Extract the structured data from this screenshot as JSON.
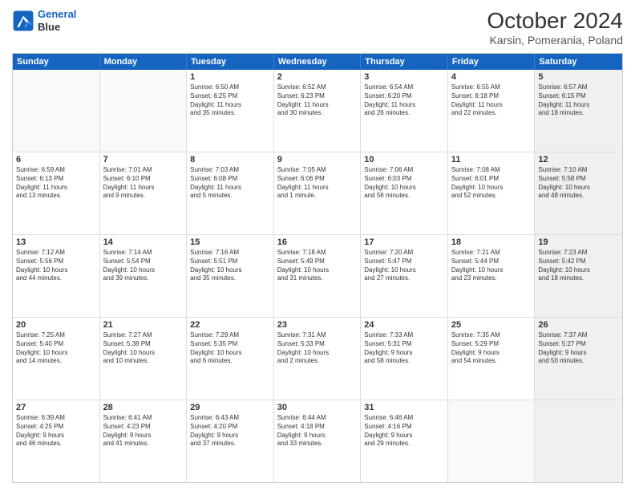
{
  "header": {
    "logo_line1": "General",
    "logo_line2": "Blue",
    "month": "October 2024",
    "location": "Karsin, Pomerania, Poland"
  },
  "weekdays": [
    "Sunday",
    "Monday",
    "Tuesday",
    "Wednesday",
    "Thursday",
    "Friday",
    "Saturday"
  ],
  "rows": [
    {
      "cells": [
        {
          "day": "",
          "info": "",
          "empty": true
        },
        {
          "day": "",
          "info": "",
          "empty": true
        },
        {
          "day": "1",
          "info": "Sunrise: 6:50 AM\nSunset: 6:25 PM\nDaylight: 11 hours\nand 35 minutes."
        },
        {
          "day": "2",
          "info": "Sunrise: 6:52 AM\nSunset: 6:23 PM\nDaylight: 11 hours\nand 30 minutes."
        },
        {
          "day": "3",
          "info": "Sunrise: 6:54 AM\nSunset: 6:20 PM\nDaylight: 11 hours\nand 26 minutes."
        },
        {
          "day": "4",
          "info": "Sunrise: 6:55 AM\nSunset: 6:18 PM\nDaylight: 11 hours\nand 22 minutes."
        },
        {
          "day": "5",
          "info": "Sunrise: 6:57 AM\nSunset: 6:15 PM\nDaylight: 11 hours\nand 18 minutes.",
          "shaded": true
        }
      ]
    },
    {
      "cells": [
        {
          "day": "6",
          "info": "Sunrise: 6:59 AM\nSunset: 6:13 PM\nDaylight: 11 hours\nand 13 minutes."
        },
        {
          "day": "7",
          "info": "Sunrise: 7:01 AM\nSunset: 6:10 PM\nDaylight: 11 hours\nand 9 minutes."
        },
        {
          "day": "8",
          "info": "Sunrise: 7:03 AM\nSunset: 6:08 PM\nDaylight: 11 hours\nand 5 minutes."
        },
        {
          "day": "9",
          "info": "Sunrise: 7:05 AM\nSunset: 6:06 PM\nDaylight: 11 hours\nand 1 minute."
        },
        {
          "day": "10",
          "info": "Sunrise: 7:06 AM\nSunset: 6:03 PM\nDaylight: 10 hours\nand 56 minutes."
        },
        {
          "day": "11",
          "info": "Sunrise: 7:08 AM\nSunset: 6:01 PM\nDaylight: 10 hours\nand 52 minutes."
        },
        {
          "day": "12",
          "info": "Sunrise: 7:10 AM\nSunset: 5:58 PM\nDaylight: 10 hours\nand 48 minutes.",
          "shaded": true
        }
      ]
    },
    {
      "cells": [
        {
          "day": "13",
          "info": "Sunrise: 7:12 AM\nSunset: 5:56 PM\nDaylight: 10 hours\nand 44 minutes."
        },
        {
          "day": "14",
          "info": "Sunrise: 7:14 AM\nSunset: 5:54 PM\nDaylight: 10 hours\nand 39 minutes."
        },
        {
          "day": "15",
          "info": "Sunrise: 7:16 AM\nSunset: 5:51 PM\nDaylight: 10 hours\nand 35 minutes."
        },
        {
          "day": "16",
          "info": "Sunrise: 7:18 AM\nSunset: 5:49 PM\nDaylight: 10 hours\nand 31 minutes."
        },
        {
          "day": "17",
          "info": "Sunrise: 7:20 AM\nSunset: 5:47 PM\nDaylight: 10 hours\nand 27 minutes."
        },
        {
          "day": "18",
          "info": "Sunrise: 7:21 AM\nSunset: 5:44 PM\nDaylight: 10 hours\nand 23 minutes."
        },
        {
          "day": "19",
          "info": "Sunrise: 7:23 AM\nSunset: 5:42 PM\nDaylight: 10 hours\nand 18 minutes.",
          "shaded": true
        }
      ]
    },
    {
      "cells": [
        {
          "day": "20",
          "info": "Sunrise: 7:25 AM\nSunset: 5:40 PM\nDaylight: 10 hours\nand 14 minutes."
        },
        {
          "day": "21",
          "info": "Sunrise: 7:27 AM\nSunset: 5:38 PM\nDaylight: 10 hours\nand 10 minutes."
        },
        {
          "day": "22",
          "info": "Sunrise: 7:29 AM\nSunset: 5:35 PM\nDaylight: 10 hours\nand 6 minutes."
        },
        {
          "day": "23",
          "info": "Sunrise: 7:31 AM\nSunset: 5:33 PM\nDaylight: 10 hours\nand 2 minutes."
        },
        {
          "day": "24",
          "info": "Sunrise: 7:33 AM\nSunset: 5:31 PM\nDaylight: 9 hours\nand 58 minutes."
        },
        {
          "day": "25",
          "info": "Sunrise: 7:35 AM\nSunset: 5:29 PM\nDaylight: 9 hours\nand 54 minutes."
        },
        {
          "day": "26",
          "info": "Sunrise: 7:37 AM\nSunset: 5:27 PM\nDaylight: 9 hours\nand 50 minutes.",
          "shaded": true
        }
      ]
    },
    {
      "cells": [
        {
          "day": "27",
          "info": "Sunrise: 6:39 AM\nSunset: 4:25 PM\nDaylight: 9 hours\nand 46 minutes."
        },
        {
          "day": "28",
          "info": "Sunrise: 6:41 AM\nSunset: 4:23 PM\nDaylight: 9 hours\nand 41 minutes."
        },
        {
          "day": "29",
          "info": "Sunrise: 6:43 AM\nSunset: 4:20 PM\nDaylight: 9 hours\nand 37 minutes."
        },
        {
          "day": "30",
          "info": "Sunrise: 6:44 AM\nSunset: 4:18 PM\nDaylight: 9 hours\nand 33 minutes."
        },
        {
          "day": "31",
          "info": "Sunrise: 6:46 AM\nSunset: 4:16 PM\nDaylight: 9 hours\nand 29 minutes."
        },
        {
          "day": "",
          "info": "",
          "empty": true
        },
        {
          "day": "",
          "info": "",
          "empty": true,
          "shaded": true
        }
      ]
    }
  ]
}
